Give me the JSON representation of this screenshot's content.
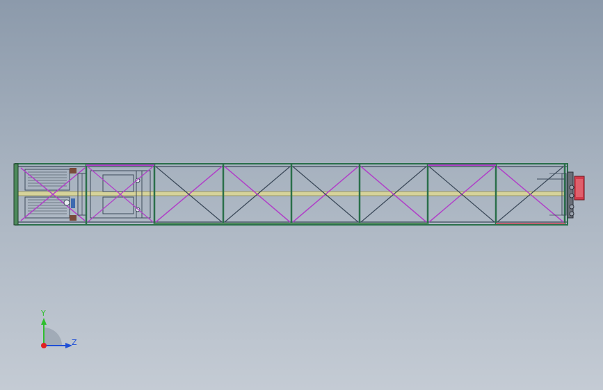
{
  "axis_triad": {
    "y_label": "Y",
    "z_label": "Z",
    "y_color": "#2fbf2f",
    "z_color": "#1f4fd6",
    "origin_color": "#e02020"
  },
  "model": {
    "frame_color": "#2a6f4a",
    "brace_magenta": "#b040c8",
    "brace_dark": "#3c4a5a",
    "rail_yellow": "#c9c78a",
    "motor_red": "#d23a4a"
  }
}
